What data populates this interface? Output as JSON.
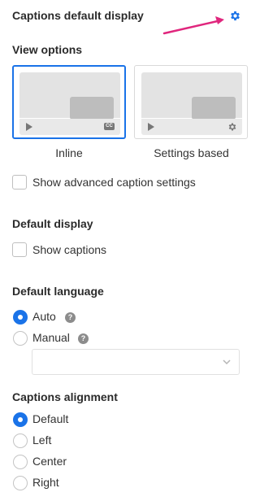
{
  "header": {
    "title": "Captions default display",
    "settings_icon": "gear-icon",
    "accent": "#1a73e8",
    "annotation_color": "#e0267d"
  },
  "view_options": {
    "heading": "View options",
    "cards": [
      {
        "label": "Inline",
        "selected": true,
        "icon": "closed-captions-icon"
      },
      {
        "label": "Settings based",
        "selected": false,
        "icon": "gear-icon"
      }
    ],
    "cc_text": "CC",
    "advanced_checkbox_label": "Show advanced caption settings"
  },
  "default_display": {
    "heading": "Default display",
    "show_captions_label": "Show captions"
  },
  "default_language": {
    "heading": "Default language",
    "options": [
      {
        "label": "Auto",
        "checked": true
      },
      {
        "label": "Manual",
        "checked": false
      }
    ],
    "help_glyph": "?",
    "select_value": ""
  },
  "alignment": {
    "heading": "Captions alignment",
    "options": [
      {
        "label": "Default",
        "checked": true
      },
      {
        "label": "Left",
        "checked": false
      },
      {
        "label": "Center",
        "checked": false
      },
      {
        "label": "Right",
        "checked": false
      }
    ]
  }
}
